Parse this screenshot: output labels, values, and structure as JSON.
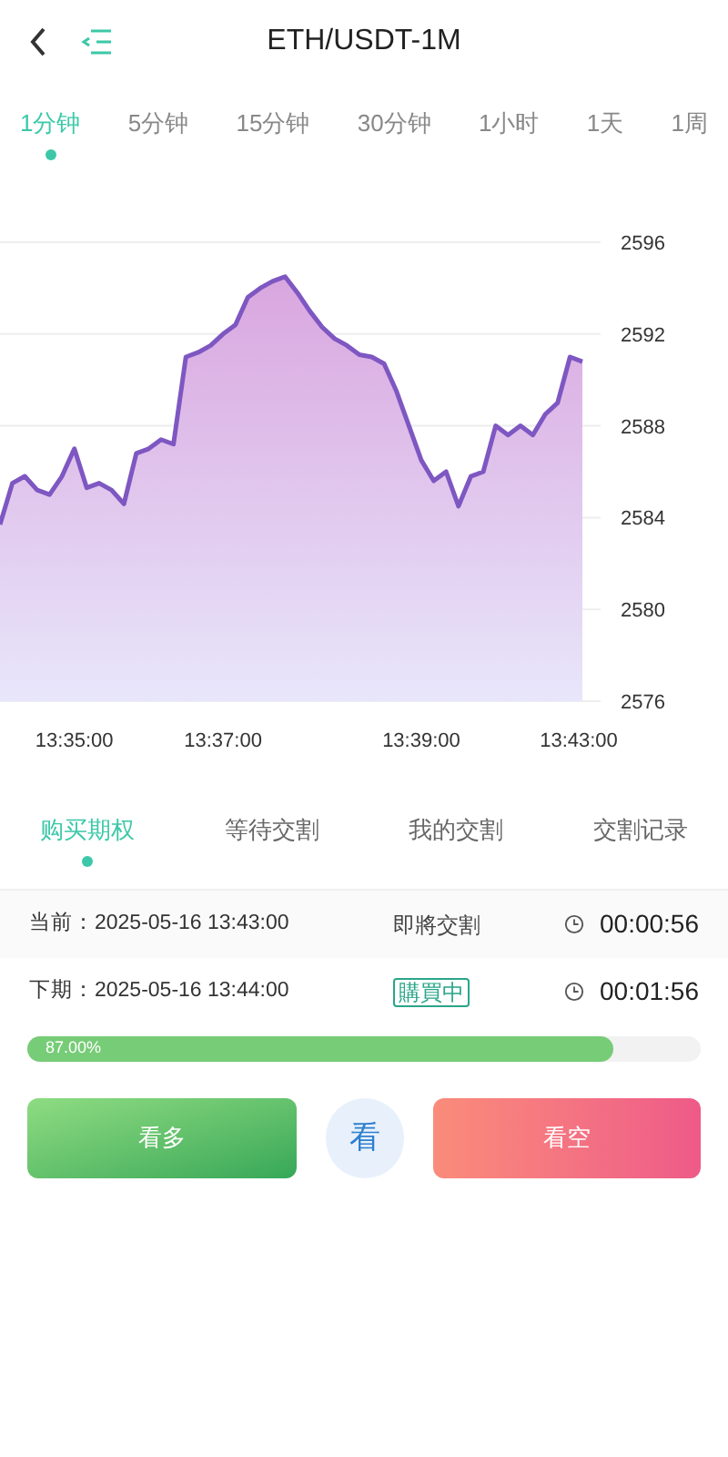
{
  "header": {
    "title": "ETH/USDT-1M"
  },
  "intervals": [
    {
      "label": "1分钟",
      "selected": true
    },
    {
      "label": "5分钟",
      "selected": false
    },
    {
      "label": "15分钟",
      "selected": false
    },
    {
      "label": "30分钟",
      "selected": false
    },
    {
      "label": "1小时",
      "selected": false
    },
    {
      "label": "1天",
      "selected": false
    },
    {
      "label": "1周",
      "selected": false
    }
  ],
  "chart": {
    "chart_data": {
      "type": "area",
      "categories": [
        null,
        null,
        null,
        null,
        null,
        null,
        "13:35:00",
        null,
        null,
        null,
        null,
        null,
        null,
        null,
        null,
        null,
        null,
        null,
        "13:37:00",
        null,
        null,
        null,
        null,
        null,
        null,
        null,
        null,
        null,
        null,
        null,
        null,
        null,
        null,
        null,
        "13:39:00",
        null,
        null,
        null,
        null,
        null,
        null,
        null,
        null,
        null,
        null,
        null,
        null,
        "13:43:00"
      ],
      "series": [
        {
          "color": "#7e57c2",
          "values": [
            2583.7,
            2585.5,
            2585.8,
            2585.2,
            2585.0,
            2585.8,
            2587.0,
            2585.3,
            2585.5,
            2585.2,
            2584.6,
            2586.8,
            2587.0,
            2587.4,
            2587.2,
            2591.0,
            2591.2,
            2591.5,
            2592.0,
            2592.4,
            2593.6,
            2594.0,
            2594.3,
            2594.5,
            2593.8,
            2593.0,
            2592.3,
            2591.8,
            2591.5,
            2591.1,
            2591.0,
            2590.7,
            2589.5,
            2588.0,
            2586.5,
            2585.6,
            2586.0,
            2584.5,
            2585.8,
            2586.0,
            2588.0,
            2587.6,
            2588.0,
            2587.6,
            2588.5,
            2589.0,
            2591.0,
            2590.8
          ]
        }
      ],
      "grid": true,
      "ylim": [
        2576,
        2596
      ],
      "yticks": [
        2576,
        2580,
        2584,
        2588,
        2592,
        2596
      ]
    }
  },
  "sections": [
    {
      "label": "购买期权",
      "selected": true
    },
    {
      "label": "等待交割",
      "selected": false
    },
    {
      "label": "我的交割",
      "selected": false
    },
    {
      "label": "交割记录",
      "selected": false
    }
  ],
  "periods": [
    {
      "label": "当前：2025-05-16 13:43:00",
      "status": {
        "kind": "plain",
        "text": "即將交割"
      },
      "countdown": "00:00:56"
    },
    {
      "label": "下期：2025-05-16 13:44:00",
      "status": {
        "kind": "badge",
        "text": "購買中"
      },
      "countdown": "00:01:56"
    }
  ],
  "progress": {
    "level": 0.87,
    "reading": "87.00%"
  },
  "actions": {
    "up": "看多",
    "middle": "看",
    "down": "看空"
  }
}
